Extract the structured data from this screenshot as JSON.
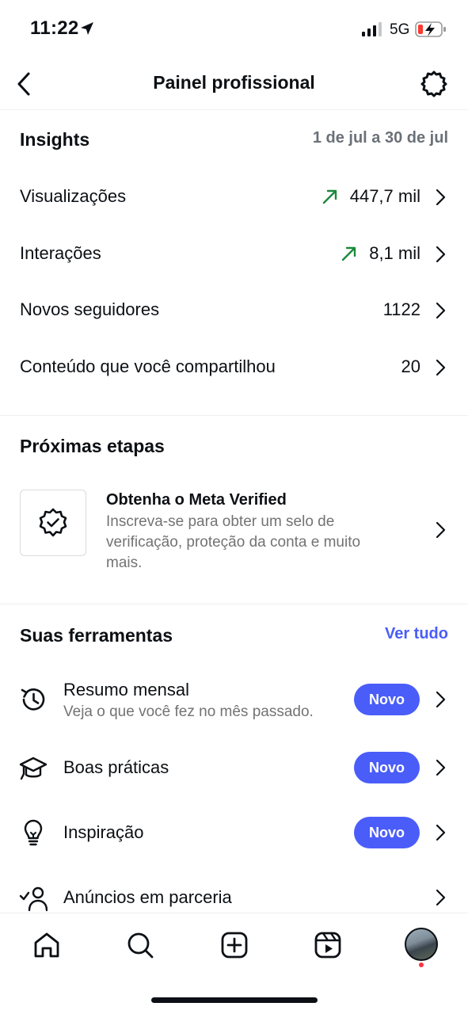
{
  "status_bar": {
    "time": "11:22",
    "network": "5G"
  },
  "header": {
    "title": "Painel profissional"
  },
  "insights": {
    "title": "Insights",
    "range": "1 de jul a 30 de jul",
    "rows": [
      {
        "label": "Visualizações",
        "value": "447,7 mil",
        "trend": "up"
      },
      {
        "label": "Interações",
        "value": "8,1 mil",
        "trend": "up"
      },
      {
        "label": "Novos seguidores",
        "value": "1122"
      },
      {
        "label": "Conteúdo que você compartilhou",
        "value": "20"
      }
    ]
  },
  "next_steps": {
    "title": "Próximas etapas",
    "card": {
      "title": "Obtenha o Meta Verified",
      "description": "Inscreva-se para obter um selo de verificação, proteção da conta e muito mais."
    }
  },
  "tools": {
    "title": "Suas ferramentas",
    "see_all": "Ver tudo",
    "items": [
      {
        "title": "Resumo mensal",
        "subtitle": "Veja o que você fez no mês passado.",
        "badge": "Novo",
        "icon": "history-icon"
      },
      {
        "title": "Boas práticas",
        "badge": "Novo",
        "icon": "graduation-cap-icon"
      },
      {
        "title": "Inspiração",
        "badge": "Novo",
        "icon": "lightbulb-icon"
      },
      {
        "title": "Anúncios em parceria",
        "icon": "partnership-ads-icon"
      }
    ]
  },
  "colors": {
    "accent": "#4a5df9",
    "trend_up": "#1a8a3a",
    "muted": "#737373"
  }
}
